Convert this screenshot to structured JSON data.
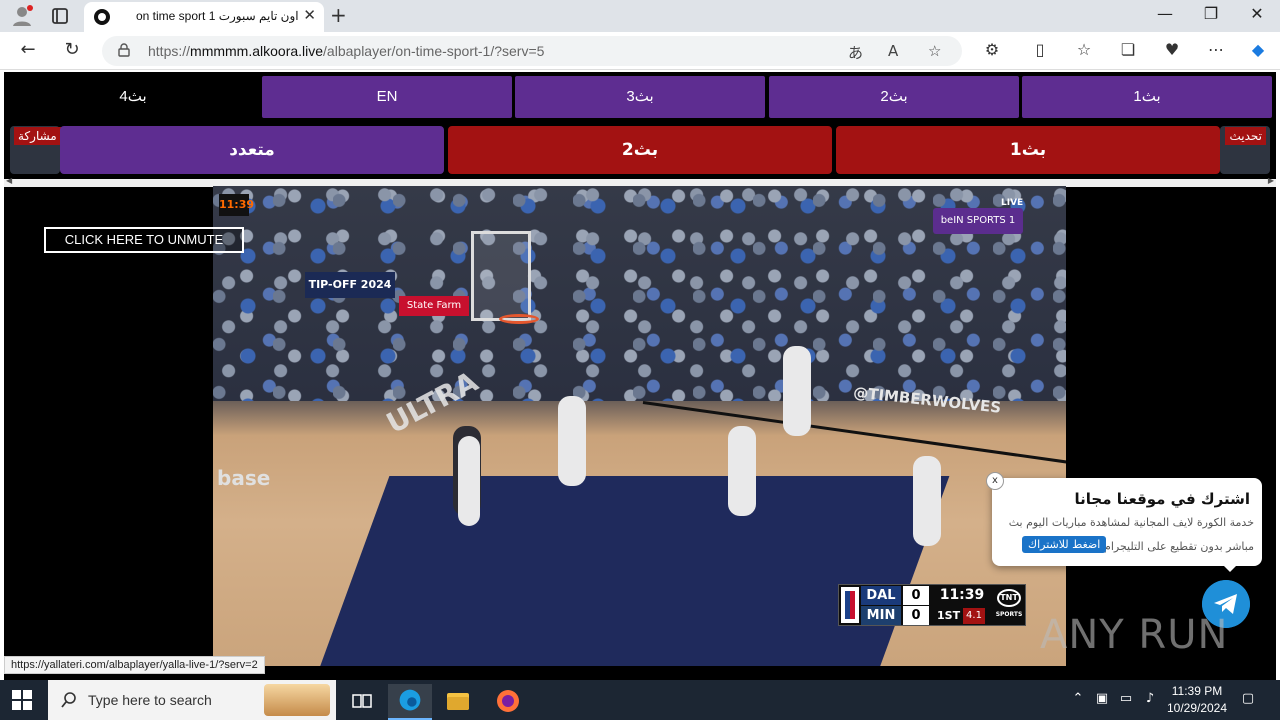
{
  "browser": {
    "tab_title": "on time sport 1 اون تايم سبورت",
    "tab_close": "✕",
    "new_tab": "+",
    "url_scheme": "https://",
    "url_host": "mmmmm.alkoora.live",
    "url_path": "/albaplayer/on-time-sport-1/?serv=5",
    "window_controls": {
      "minimize": "—",
      "maximize": "❐",
      "close": "✕"
    }
  },
  "servers": {
    "row1": [
      {
        "label": "بث4",
        "color": "#a31212"
      },
      {
        "label": "EN",
        "color": "#5e2d91"
      },
      {
        "label": "بث3",
        "color": "#5e2d91"
      },
      {
        "label": "بث2",
        "color": "#5e2d91"
      },
      {
        "label": "بث1",
        "color": "#5e2d91"
      }
    ],
    "row2": [
      {
        "label": "متعدد",
        "color": "#5e2d91"
      },
      {
        "label": "بث2",
        "color": "#a31212"
      },
      {
        "label": "بث1",
        "color": "#a31212"
      }
    ],
    "share_label": "مشاركة",
    "refresh_label": "تحديث"
  },
  "video": {
    "unmute_label": "CLICK HERE TO UNMUTE",
    "shot_clock": "11:39",
    "tipoff_banner": "TIP-OFF 2024",
    "sponsor_banner": "State Farm",
    "floor_text": "ULTRA",
    "base_text": "base",
    "wolves_text": "@TIMBERWOLVES",
    "network_logo": "beIN SPORTS 1",
    "live_tag": "LIVE",
    "scoreboard": {
      "team1": "DAL",
      "score1": "0",
      "team2": "MIN",
      "score2": "0",
      "clock": "11:39",
      "quarter": "1ST",
      "shot_clock": "4.1",
      "broadcaster": "TNT",
      "broadcaster_sub": "SPORTS"
    }
  },
  "popup": {
    "close": "x",
    "title": "اشترك في موقعنا مجانا",
    "line1": "خدمة الكورة لايف المجانية لمشاهدة مباريات اليوم بث",
    "line2": "مباشر بدون تقطيع على التليجرام",
    "cta": "اضغط للاشتراك"
  },
  "watermark": "ANY RUN",
  "status_url": "https://yallateri.com/albaplayer/yalla-live-1/?serv=2",
  "taskbar": {
    "search_placeholder": "Type here to search",
    "time": "11:39 PM",
    "date": "10/29/2024"
  }
}
